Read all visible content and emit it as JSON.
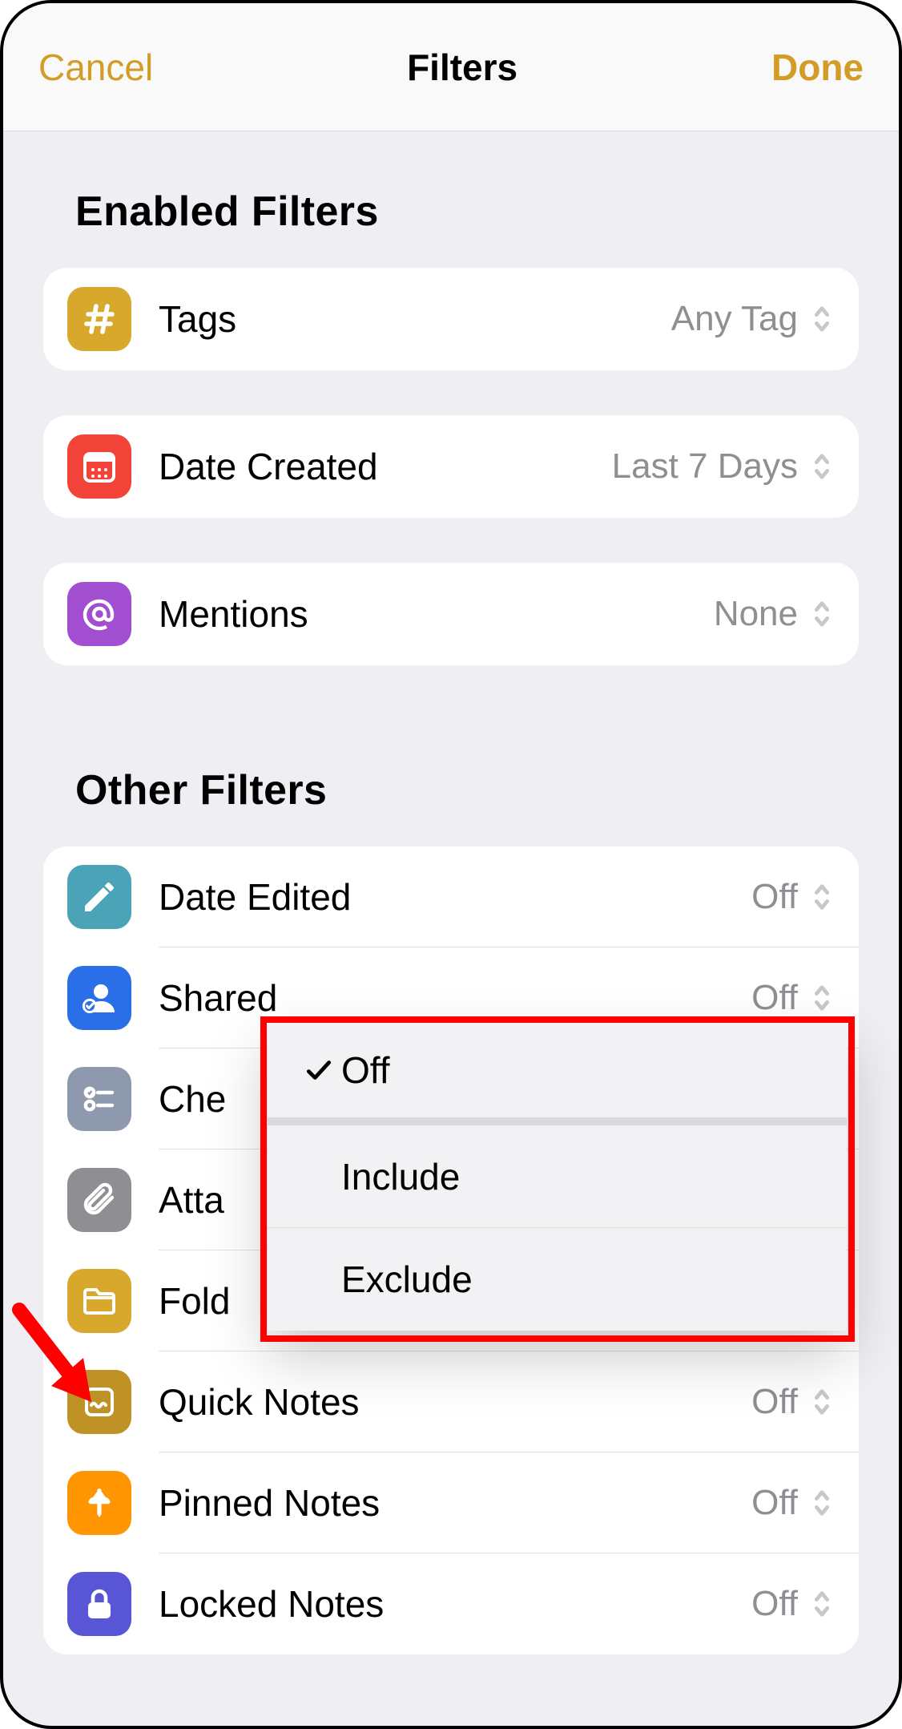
{
  "nav": {
    "cancel": "Cancel",
    "title": "Filters",
    "done": "Done"
  },
  "sections": {
    "enabled_title": "Enabled Filters",
    "other_title": "Other Filters"
  },
  "enabled": [
    {
      "id": "tags",
      "icon": "hash-icon",
      "color": "c-yellow",
      "label": "Tags",
      "value": "Any Tag"
    },
    {
      "id": "date",
      "icon": "calendar-icon",
      "color": "c-red",
      "label": "Date Created",
      "value": "Last 7 Days"
    },
    {
      "id": "mentions",
      "icon": "at-icon",
      "color": "c-purple",
      "label": "Mentions",
      "value": "None"
    }
  ],
  "other": [
    {
      "id": "date-edited",
      "icon": "pencil-icon",
      "color": "c-teal",
      "label": "Date Edited",
      "value": "Off"
    },
    {
      "id": "shared",
      "icon": "shared-icon",
      "color": "c-blue",
      "label": "Shared",
      "value": "Off"
    },
    {
      "id": "checklists",
      "icon": "checklist-icon",
      "color": "c-slate",
      "label": "Che",
      "value": ""
    },
    {
      "id": "attachments",
      "icon": "paperclip-icon",
      "color": "c-gray",
      "label": "Atta",
      "value": ""
    },
    {
      "id": "folders",
      "icon": "folder-icon",
      "color": "c-gold",
      "label": "Fold",
      "value": ""
    },
    {
      "id": "quick",
      "icon": "quicknote-icon",
      "color": "c-darkgold",
      "label": "Quick Notes",
      "value": "Off"
    },
    {
      "id": "pinned",
      "icon": "pin-icon",
      "color": "c-orange",
      "label": "Pinned Notes",
      "value": "Off"
    },
    {
      "id": "locked",
      "icon": "lock-icon",
      "color": "c-indigo",
      "label": "Locked Notes",
      "value": "Off"
    }
  ],
  "popup": {
    "options": [
      {
        "label": "Off",
        "checked": true
      },
      {
        "label": "Include",
        "checked": false
      },
      {
        "label": "Exclude",
        "checked": false
      }
    ]
  }
}
